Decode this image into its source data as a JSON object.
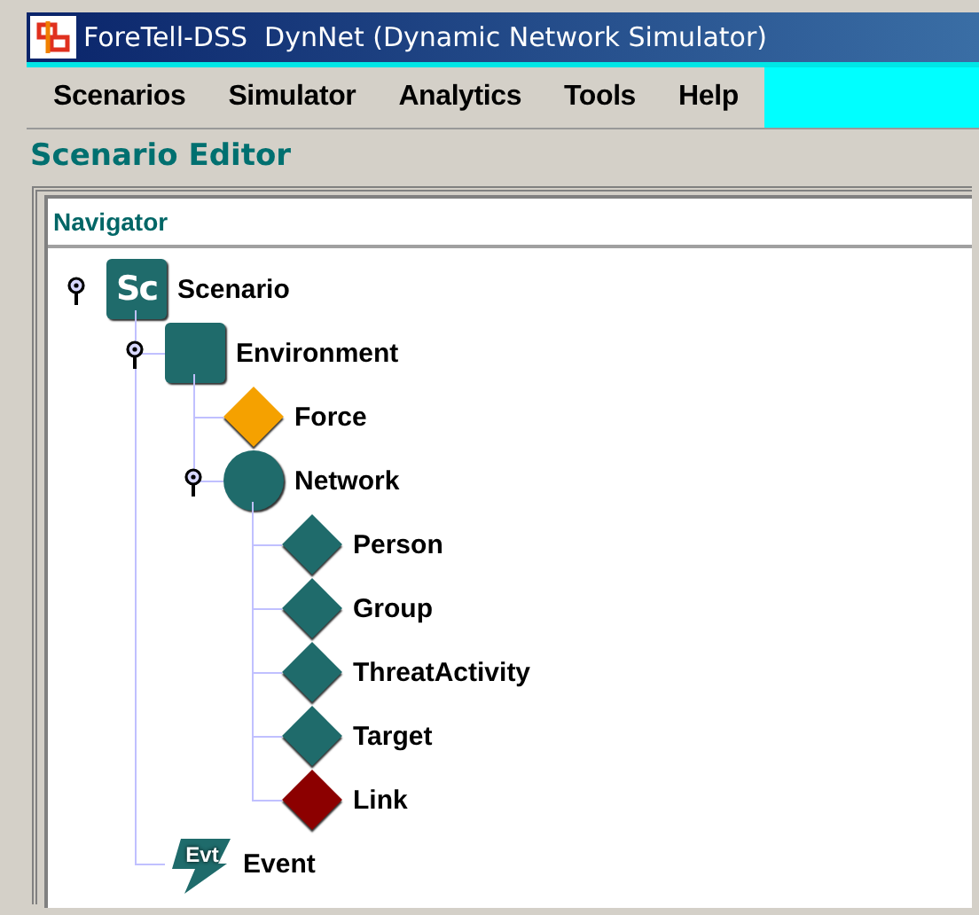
{
  "window": {
    "title": "ForeTell-DSS  DynNet (Dynamic Network Simulator)"
  },
  "menu": [
    {
      "label": "Scenarios"
    },
    {
      "label": "Simulator"
    },
    {
      "label": "Analytics"
    },
    {
      "label": "Tools"
    },
    {
      "label": "Help"
    }
  ],
  "editor": {
    "title": "Scenario Editor"
  },
  "navigator": {
    "title": "Navigator",
    "tree": [
      {
        "label": "Scenario",
        "kind": "badge",
        "badge": "Sc",
        "color": "#1f6b6b",
        "expanded": true,
        "children": [
          {
            "label": "Environment",
            "kind": "square",
            "color": "#1f6b6b",
            "expanded": true,
            "children": [
              {
                "label": "Force",
                "kind": "diamond",
                "color": "#f5a100"
              },
              {
                "label": "Network",
                "kind": "circle",
                "color": "#1f6b6b",
                "expanded": true,
                "children": [
                  {
                    "label": "Person",
                    "kind": "diamond",
                    "color": "#1f6b6b"
                  },
                  {
                    "label": "Group",
                    "kind": "diamond",
                    "color": "#1f6b6b"
                  },
                  {
                    "label": "ThreatActivity",
                    "kind": "diamond",
                    "color": "#1f6b6b"
                  },
                  {
                    "label": "Target",
                    "kind": "diamond",
                    "color": "#1f6b6b"
                  },
                  {
                    "label": "Link",
                    "kind": "diamond",
                    "color": "#8c0000"
                  }
                ]
              }
            ]
          },
          {
            "label": "Event",
            "kind": "event",
            "badge": "Evt",
            "color": "#1f6b6b"
          }
        ]
      }
    ]
  }
}
